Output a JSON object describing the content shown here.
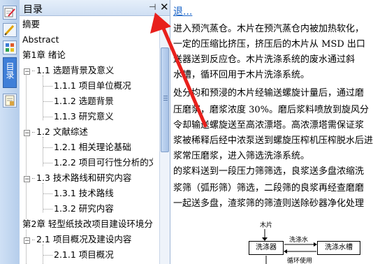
{
  "toc": {
    "title": "目录",
    "pin_glyph": "⊣",
    "close_glyph": "✕",
    "items": [
      {
        "label": "摘要",
        "level": 0,
        "toggle": ""
      },
      {
        "label": "Abstract",
        "level": 0,
        "toggle": ""
      },
      {
        "label": "第1章 绪论",
        "level": 0,
        "toggle": ""
      },
      {
        "label": "1.1 选题背景及意义",
        "level": 1,
        "toggle": "−"
      },
      {
        "label": "1.1.1 项目单位概况",
        "level": 2,
        "toggle": ""
      },
      {
        "label": "1.1.2 选题背景",
        "level": 2,
        "toggle": ""
      },
      {
        "label": "1.1.3 研究意义",
        "level": 2,
        "toggle": ""
      },
      {
        "label": "1.2 文献综述",
        "level": 1,
        "toggle": "−"
      },
      {
        "label": "1.2.1 相关理论基础",
        "level": 2,
        "toggle": ""
      },
      {
        "label": "1.2.2 项目可行性分析的文",
        "level": 2,
        "toggle": ""
      },
      {
        "label": "1.3 技术路线和研究内容",
        "level": 1,
        "toggle": "−"
      },
      {
        "label": "1.3.1 技术路线",
        "level": 2,
        "toggle": ""
      },
      {
        "label": "1.3.2 研究内容",
        "level": 2,
        "toggle": ""
      },
      {
        "label": "第2章 轻型纸技改项目建设环境分",
        "level": 0,
        "toggle": ""
      },
      {
        "label": "2.1 项目概况及建设内容",
        "level": 1,
        "toggle": "−"
      },
      {
        "label": "2.1.1 项目概况",
        "level": 2,
        "toggle": ""
      }
    ]
  },
  "sidebar": {
    "vertical_tab_label": "目录"
  },
  "document": {
    "link_text": "退...",
    "lines": [
      "进入预汽蒸仓。木片在预汽蒸仓内被加热软化，",
      "一定的压缩比挤压，挤压后的木片从 MSD 出口",
      "送器送到反应仓。木片洗涤系统的废水通过斜",
      "水槽，循环回用于木片洗涤系统。",
      "处分均和预浸的木片经输送螺旋计量后，通过磨",
      "压磨浆，磨浆浓度 30%。磨后浆料喷放到旋风分",
      "令却输送螺旋送至高浓漂塔。高浓漂塔需保证浆",
      "浆被稀释后经中浓泵送到螺旋压榨机压榨脱水后进",
      "浆常压磨浆，进入筛选洗涤系统。",
      "的浆料送到一段压力筛筛选，良浆送多盘浓缩洗",
      "浆筛（弧形筛）筛选，二段筛的良浆再经查磨磨",
      "一起送多盘，渣浆筛的筛渣则送除砂器净化处理"
    ],
    "flow": {
      "top_label": "木片",
      "box_washer": "洗涤器",
      "box_tank": "洗涤水槽",
      "arrow_water": "洗涤水",
      "arrow_recycle": "循环使用"
    }
  },
  "colors": {
    "annotation_arrow": "#e8201c",
    "link": "#1a64c8",
    "vertical_tab": "#3f7fd8"
  }
}
